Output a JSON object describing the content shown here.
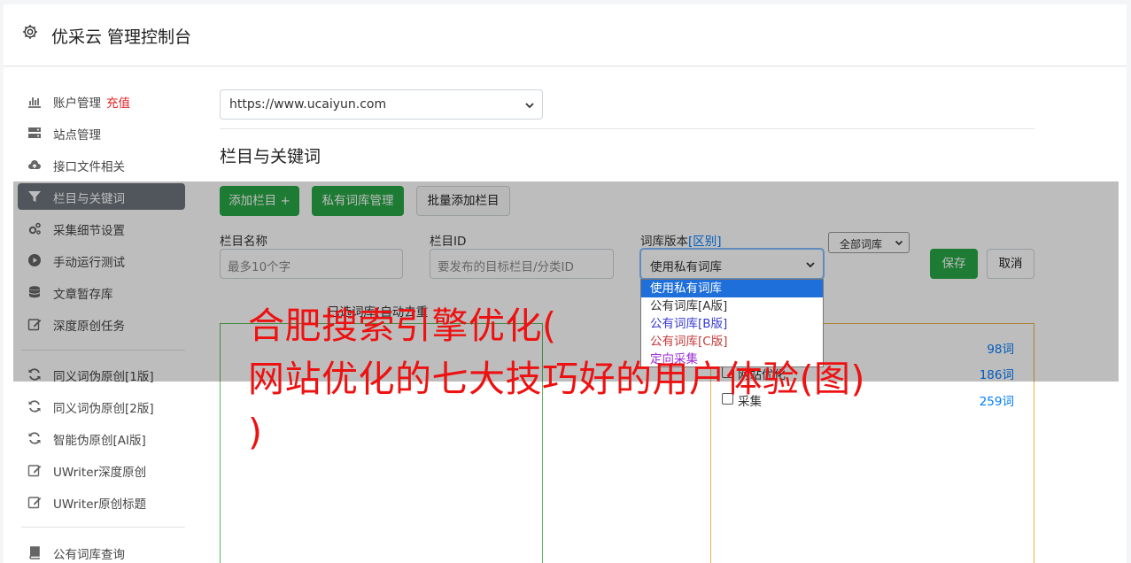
{
  "header": {
    "title": "优采云 管理控制台",
    "icon": "gear-icon"
  },
  "sidebar": {
    "items": [
      {
        "label": "账户管理",
        "badge": "充值",
        "icon": "bar-chart-icon"
      },
      {
        "label": "站点管理",
        "icon": "server-icon"
      },
      {
        "label": "接口文件相关",
        "icon": "cloud-upload-icon"
      },
      {
        "label": "栏目与关键词",
        "icon": "filter-icon",
        "active": true
      },
      {
        "label": "采集细节设置",
        "icon": "cogs-icon"
      },
      {
        "label": "手动运行测试",
        "icon": "play-circle-icon"
      },
      {
        "label": "文章暂存库",
        "icon": "database-icon"
      },
      {
        "label": "深度原创任务",
        "icon": "edit-icon"
      },
      {
        "label": "同义词伪原创[1版]",
        "icon": "refresh-icon"
      },
      {
        "label": "同义词伪原创[2版]",
        "icon": "refresh-icon"
      },
      {
        "label": "智能伪原创[AI版]",
        "icon": "refresh-icon"
      },
      {
        "label": "UWriter深度原创",
        "icon": "edit-icon"
      },
      {
        "label": "UWriter原创标题",
        "icon": "edit-icon"
      },
      {
        "label": "公有词库查询",
        "icon": "book-icon"
      }
    ]
  },
  "main": {
    "site_select": "https://www.ucaiyun.com",
    "section_title": "栏目与关键词",
    "buttons": {
      "add_column": "添加栏目 +",
      "private_lib": "私有词库管理",
      "batch_add": "批量添加栏目",
      "save": "保存",
      "cancel": "取消"
    },
    "fields": {
      "column_name_label": "栏目名称",
      "column_name_placeholder": "最多10个字",
      "column_id_label": "栏目ID",
      "column_id_placeholder": "要发布的目标栏目/分类ID",
      "lib_version_label": "词库版本",
      "lib_version_link": "[区别]",
      "lib_version_value": "使用私有词库"
    },
    "dropdown_options": [
      {
        "label": "使用私有词库",
        "selected": true,
        "color": "#ffffff"
      },
      {
        "label": "公有词库[A版]",
        "color": "#333333"
      },
      {
        "label": "公有词库[B版]",
        "color": "#3a3ad0"
      },
      {
        "label": "公有词库[C版]",
        "color": "#c43b3b"
      },
      {
        "label": "定向采集",
        "color": "#9b2fd0"
      }
    ],
    "selected_label": "已选词库(自动去重",
    "filter_select": "全部词库",
    "libraries": [
      {
        "name": "",
        "count": "98词"
      },
      {
        "name": "网站优化",
        "count": "186词"
      },
      {
        "name": "采集",
        "count": "259词"
      }
    ]
  },
  "article_headline": {
    "line1": "合肥搜索引擎优化(",
    "line2": "网站优化的七大技巧好的用户体验(图)",
    "line3": ")"
  },
  "colors": {
    "accent_green": "#28a745",
    "link_blue": "#007bff",
    "headline_red": "#ee1111",
    "left_panel_border": "#5cb85c",
    "right_panel_border": "#e8b04a"
  }
}
